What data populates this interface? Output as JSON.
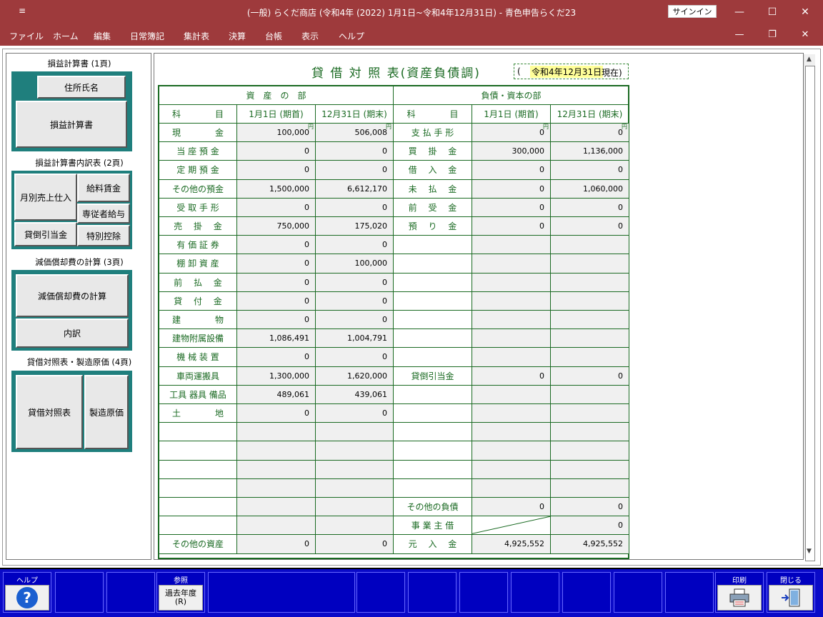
{
  "window": {
    "system_menu_glyph": "≡",
    "title": "(一般) らくだ商店 (令和4年 (2022) 1月1日~令和4年12月31日)  -  青色申告らくだ23",
    "signin_label": "サインイン",
    "minimize": "—",
    "maximize": "☐",
    "close": "✕"
  },
  "menubar": {
    "items": [
      "ファイル",
      "ホーム",
      "編集",
      "日常簿記",
      "集計表",
      "決算",
      "台帳",
      "表示",
      "ヘルプ"
    ]
  },
  "left_panel": {
    "section1": {
      "title": "損益計算書 (1頁)",
      "btn_name": "住所氏名",
      "btn_pl": "損益計算書"
    },
    "section2": {
      "title": "損益計算書内訳表 (2頁)",
      "btn_monthly": "月別売上仕入",
      "btn_salary": "給料賃金",
      "btn_family": "専従者給与",
      "btn_baddebt": "貸倒引当金",
      "btn_special": "特別控除"
    },
    "section3": {
      "title": "減価償却費の計算 (3頁)",
      "btn_calc": "減価償却費の計算",
      "btn_detail": "内訳"
    },
    "section4": {
      "title": "貸借対照表・製造原価 (4頁)",
      "btn_bs": "貸借対照表",
      "btn_mfg": "製造原価"
    }
  },
  "document": {
    "title": "貸 借 対 照 表(資産負債調)",
    "date_open": "(",
    "date": "令和4年12月31日",
    "date_close": "現在)"
  },
  "table": {
    "assets_header": "資　産　の　部",
    "liab_header": "負債・資本の部",
    "col_item": "科　　　　目",
    "col_start": "1月1日 (期首)",
    "col_end": "12月31日 (期末)",
    "yen": "円",
    "assets": [
      {
        "name": "現　　　　金",
        "start": "100,000",
        "end": "506,008"
      },
      {
        "name": "当 座 預 金",
        "start": "0",
        "end": "0"
      },
      {
        "name": "定 期 預 金",
        "start": "0",
        "end": "0"
      },
      {
        "name": "その他の預金",
        "start": "1,500,000",
        "end": "6,612,170"
      },
      {
        "name": "受 取 手 形",
        "start": "0",
        "end": "0"
      },
      {
        "name": "売　 掛　 金",
        "start": "750,000",
        "end": "175,020"
      },
      {
        "name": "有 価 証 券",
        "start": "0",
        "end": "0"
      },
      {
        "name": "棚 卸 資 産",
        "start": "0",
        "end": "100,000"
      },
      {
        "name": "前　 払　 金",
        "start": "0",
        "end": "0"
      },
      {
        "name": "貸　 付　 金",
        "start": "0",
        "end": "0"
      },
      {
        "name": "建　　　　物",
        "start": "0",
        "end": "0"
      },
      {
        "name": "建物附属設備",
        "start": "1,086,491",
        "end": "1,004,791"
      },
      {
        "name": "機 械 装 置",
        "start": "0",
        "end": "0"
      },
      {
        "name": "車両運搬具",
        "start": "1,300,000",
        "end": "1,620,000"
      },
      {
        "name": "工具 器具 備品",
        "start": "489,061",
        "end": "439,061"
      },
      {
        "name": "土　　　　地",
        "start": "0",
        "end": "0"
      },
      {
        "name": "",
        "start": "",
        "end": ""
      },
      {
        "name": "",
        "start": "",
        "end": ""
      },
      {
        "name": "",
        "start": "",
        "end": ""
      },
      {
        "name": "",
        "start": "",
        "end": ""
      },
      {
        "name": "",
        "start": "",
        "end": ""
      },
      {
        "name": "",
        "start": "",
        "end": ""
      },
      {
        "name": "その他の資産",
        "start": "0",
        "end": "0"
      }
    ],
    "liabilities": [
      {
        "name": "支 払 手 形",
        "start": "0",
        "end": "0"
      },
      {
        "name": "買　 掛　 金",
        "start": "300,000",
        "end": "1,136,000"
      },
      {
        "name": "借　 入　 金",
        "start": "0",
        "end": "0"
      },
      {
        "name": "未　 払　 金",
        "start": "0",
        "end": "1,060,000"
      },
      {
        "name": "前　 受　 金",
        "start": "0",
        "end": "0"
      },
      {
        "name": "預　 り　 金",
        "start": "0",
        "end": "0"
      },
      {
        "name": "",
        "start": "",
        "end": ""
      },
      {
        "name": "",
        "start": "",
        "end": ""
      },
      {
        "name": "",
        "start": "",
        "end": ""
      },
      {
        "name": "",
        "start": "",
        "end": ""
      },
      {
        "name": "",
        "start": "",
        "end": ""
      },
      {
        "name": "",
        "start": "",
        "end": ""
      },
      {
        "name": "",
        "start": "",
        "end": ""
      },
      {
        "name": "貸倒引当金",
        "start": "0",
        "end": "0"
      },
      {
        "name": "",
        "start": "",
        "end": ""
      },
      {
        "name": "",
        "start": "",
        "end": ""
      },
      {
        "name": "",
        "start": "",
        "end": ""
      },
      {
        "name": "",
        "start": "",
        "end": ""
      },
      {
        "name": "",
        "start": "",
        "end": ""
      },
      {
        "name": "",
        "start": "",
        "end": ""
      },
      {
        "name": "その他の負債",
        "start": "0",
        "end": "0"
      },
      {
        "name": "事 業 主 借",
        "start": "",
        "end": "0"
      },
      {
        "name": "元　 入　 金",
        "start": "4,925,552",
        "end": "4,925,552"
      }
    ]
  },
  "funcbar": {
    "help_label": "ヘルプ",
    "help_icon": "?",
    "ref_label": "参照",
    "ref_btn": "過去年度\n(R)",
    "print_label": "印刷",
    "close_label": "閉じる"
  }
}
